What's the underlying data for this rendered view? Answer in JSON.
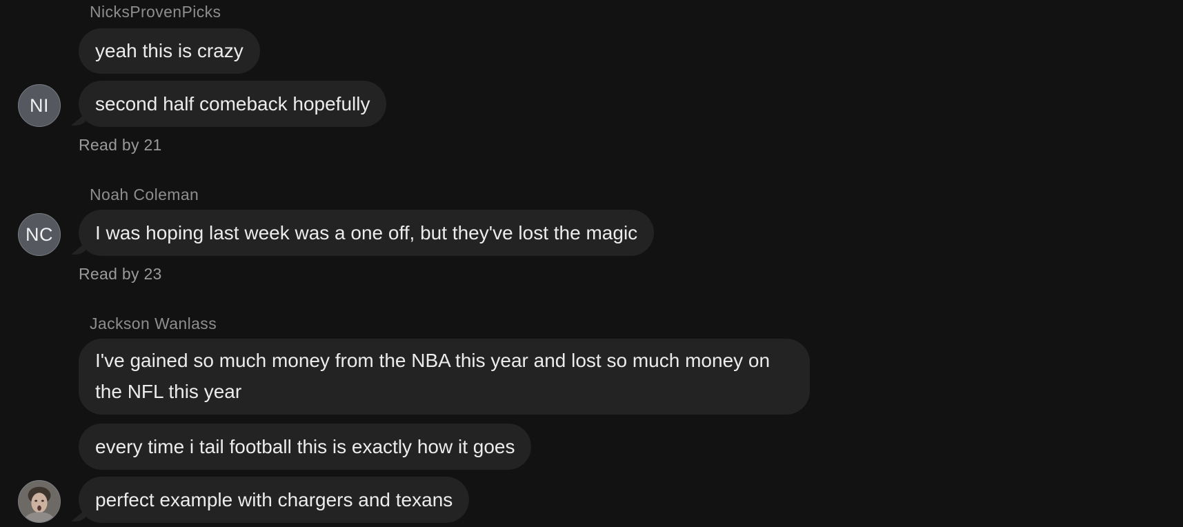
{
  "groups": [
    {
      "sender": "NicksProvenPicks",
      "avatar_initials": "NI",
      "messages": [
        "yeah this is crazy",
        "second half comeback hopefully"
      ],
      "read_receipt": "Read by 21"
    },
    {
      "sender": "Noah Coleman",
      "avatar_initials": "NC",
      "messages": [
        "I was hoping last week was a one off, but they've lost the magic"
      ],
      "read_receipt": "Read by 23"
    },
    {
      "sender": "Jackson Wanlass",
      "avatar": "profile-photo",
      "messages": [
        "I've gained so much money from the NBA this year and lost so much money on the NFL this year",
        "every time i tail football this is exactly how it goes",
        "perfect example with chargers and texans"
      ]
    }
  ],
  "colors": {
    "background": "#121212",
    "bubble": "#232323",
    "text": "#ececec",
    "meta": "#8e8e8e",
    "avatar": "#55595f"
  }
}
